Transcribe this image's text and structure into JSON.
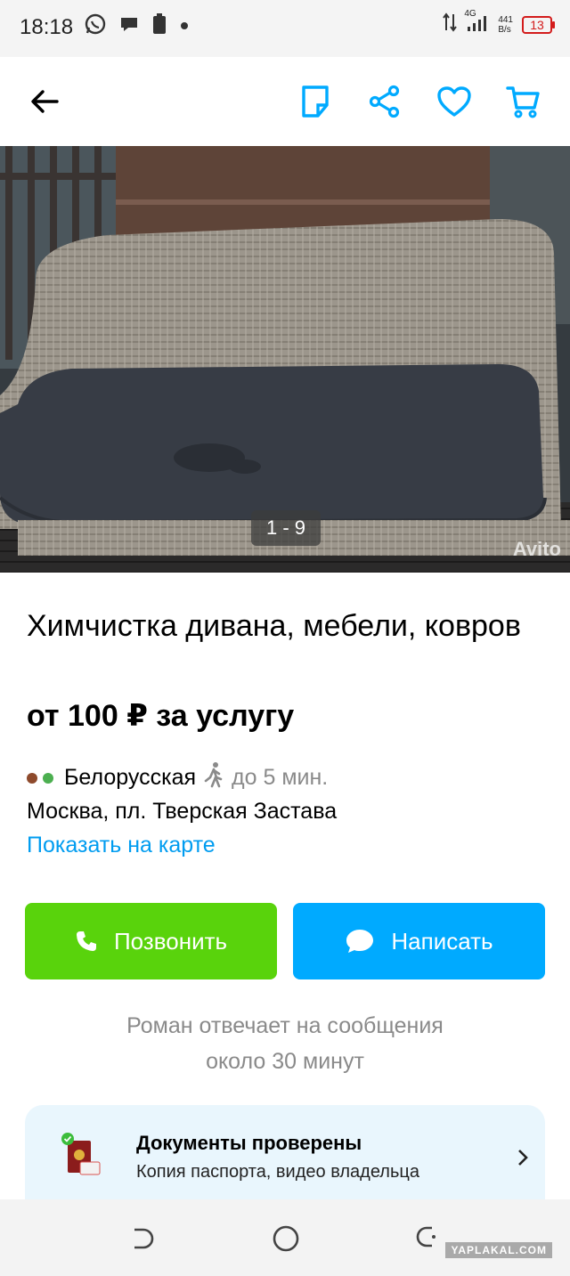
{
  "status_bar": {
    "time": "18:18",
    "net_type": "4G",
    "net_speed_value": "441",
    "net_speed_unit": "B/s",
    "battery": "13"
  },
  "topbar": {
    "icons": [
      "back-arrow-icon",
      "note-icon",
      "share-icon",
      "heart-icon",
      "cart-icon"
    ]
  },
  "photo": {
    "counter": "1 - 9",
    "watermark": "Avito"
  },
  "listing": {
    "title": "Химчистка дивана, мебели, ковров",
    "price": "от 100 ₽ за услугу",
    "metro_station": "Белорусская",
    "metro_dot_colors": [
      "#8e4a2c",
      "#4caf50"
    ],
    "walk_time": "до 5 мин.",
    "address": "Москва, пл. Тверская Застава",
    "map_link": "Показать на карте"
  },
  "actions": {
    "call_label": "Позвонить",
    "message_label": "Написать"
  },
  "reply_note": {
    "line1": "Роман отвечает на сообщения",
    "line2": "около 30 минут"
  },
  "documents": {
    "title": "Документы проверены",
    "subtitle": "Копия паспорта, видео владельца"
  },
  "footer": {
    "watermark": "YAPLAKAL.COM"
  },
  "colors": {
    "accent_blue": "#009cf0",
    "call_green": "#59d30c",
    "message_blue": "#00aaff",
    "battery_red": "#d31b1b"
  }
}
